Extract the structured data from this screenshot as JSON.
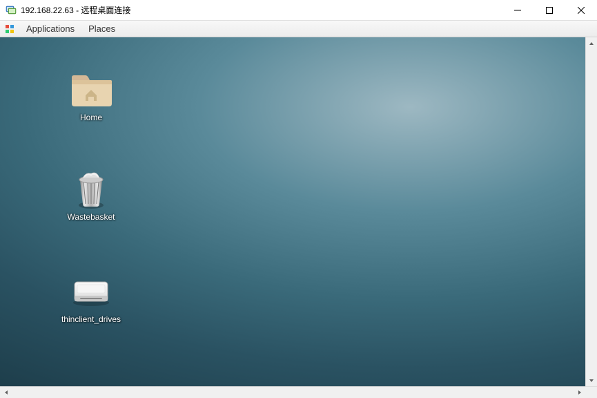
{
  "window": {
    "title": "192.168.22.63 - 远程桌面连接"
  },
  "menubar": {
    "applications": "Applications",
    "places": "Places"
  },
  "desktop": {
    "icons": {
      "home": {
        "label": "Home"
      },
      "wastebasket": {
        "label": "Wastebasket"
      },
      "thinclient_drives": {
        "label": "thinclient_drives"
      }
    }
  }
}
